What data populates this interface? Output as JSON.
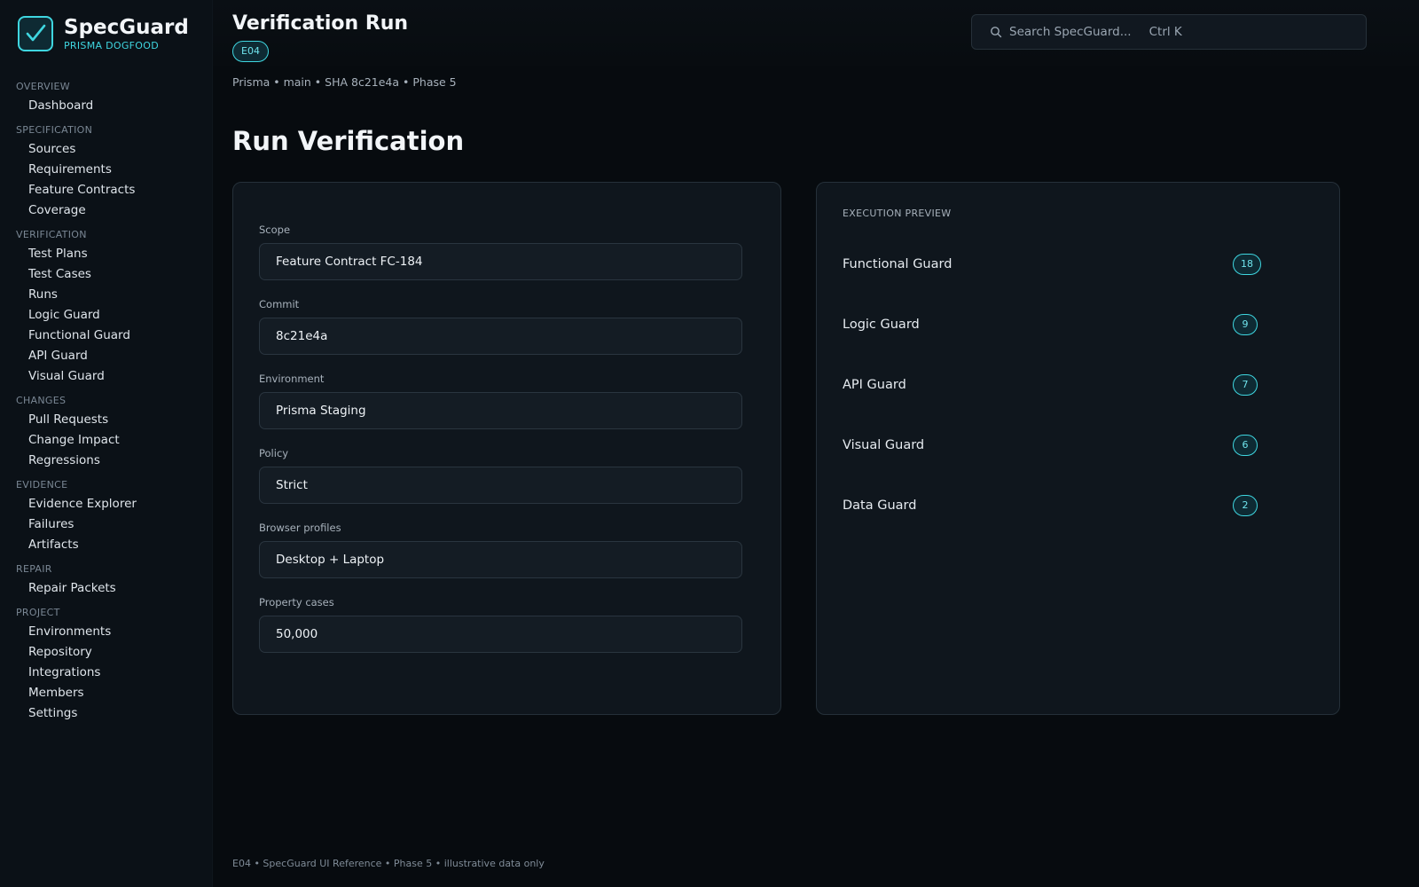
{
  "brand": {
    "name": "SpecGuard",
    "subtitle": "PRISMA DOGFOOD"
  },
  "nav": [
    {
      "heading": "OVERVIEW",
      "items": [
        "Dashboard"
      ]
    },
    {
      "heading": "SPECIFICATION",
      "items": [
        "Sources",
        "Requirements",
        "Feature Contracts",
        "Coverage"
      ]
    },
    {
      "heading": "VERIFICATION",
      "items": [
        "Test Plans",
        "Test Cases",
        "Runs",
        "Logic Guard",
        "Functional Guard",
        "API Guard",
        "Visual Guard"
      ]
    },
    {
      "heading": "CHANGES",
      "items": [
        "Pull Requests",
        "Change Impact",
        "Regressions"
      ]
    },
    {
      "heading": "EVIDENCE",
      "items": [
        "Evidence Explorer",
        "Failures",
        "Artifacts"
      ]
    },
    {
      "heading": "REPAIR",
      "items": [
        "Repair Packets"
      ]
    },
    {
      "heading": "PROJECT",
      "items": [
        "Environments",
        "Repository",
        "Integrations",
        "Members",
        "Settings"
      ]
    }
  ],
  "header": {
    "title": "Verification Run",
    "badge": "E04",
    "search_placeholder": "Search SpecGuard...",
    "search_shortcut": "Ctrl K",
    "meta": "Prisma • main • SHA 8c21e4a • Phase 5"
  },
  "main": {
    "title": "Run Verification",
    "form": {
      "fields": [
        {
          "label": "Scope",
          "value": "Feature Contract FC-184"
        },
        {
          "label": "Commit",
          "value": "8c21e4a"
        },
        {
          "label": "Environment",
          "value": "Prisma Staging"
        },
        {
          "label": "Policy",
          "value": "Strict"
        },
        {
          "label": "Browser profiles",
          "value": "Desktop + Laptop"
        },
        {
          "label": "Property cases",
          "value": "50,000"
        }
      ]
    },
    "preview": {
      "heading": "EXECUTION PREVIEW",
      "rows": [
        {
          "name": "Functional Guard",
          "count": "18"
        },
        {
          "name": "Logic Guard",
          "count": "9"
        },
        {
          "name": "API Guard",
          "count": "7"
        },
        {
          "name": "Visual Guard",
          "count": "6"
        },
        {
          "name": "Data Guard",
          "count": "2"
        }
      ]
    }
  },
  "footer": "E04 • SpecGuard UI Reference • Phase 5 • illustrative data only",
  "colors": {
    "accent": "#3fd6e0",
    "background": "#070b0f",
    "card": "#0f161d"
  }
}
